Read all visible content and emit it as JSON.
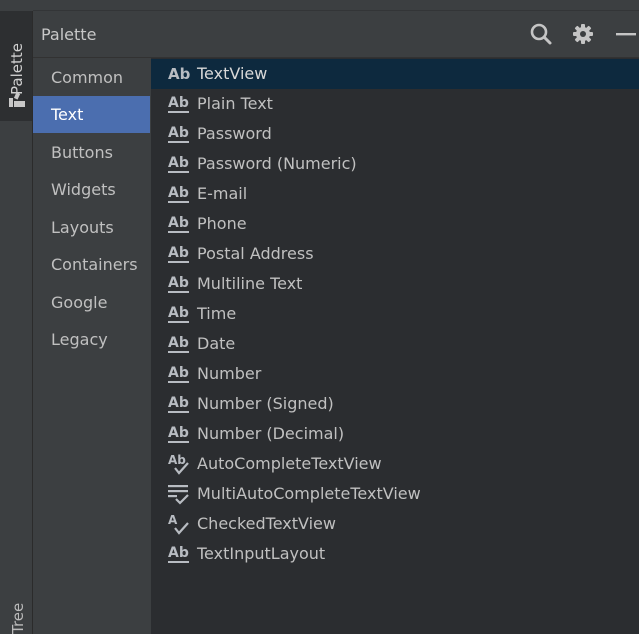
{
  "side_strip": {
    "palette_tab": "Palette",
    "tree_tab": "Tree"
  },
  "header": {
    "title": "Palette",
    "icons": [
      "search-icon",
      "gear-icon",
      "minimize-icon"
    ]
  },
  "categories": [
    {
      "label": "Common"
    },
    {
      "label": "Text",
      "selected": true
    },
    {
      "label": "Buttons"
    },
    {
      "label": "Widgets"
    },
    {
      "label": "Layouts"
    },
    {
      "label": "Containers"
    },
    {
      "label": "Google"
    },
    {
      "label": "Legacy"
    }
  ],
  "items": [
    {
      "label": "TextView",
      "icon": "textview-icon",
      "selected": true
    },
    {
      "label": "Plain Text",
      "icon": "edittext-icon"
    },
    {
      "label": "Password",
      "icon": "edittext-icon"
    },
    {
      "label": "Password (Numeric)",
      "icon": "edittext-icon"
    },
    {
      "label": "E-mail",
      "icon": "edittext-icon"
    },
    {
      "label": "Phone",
      "icon": "edittext-icon"
    },
    {
      "label": "Postal Address",
      "icon": "edittext-icon"
    },
    {
      "label": "Multiline Text",
      "icon": "edittext-icon"
    },
    {
      "label": "Time",
      "icon": "edittext-icon"
    },
    {
      "label": "Date",
      "icon": "edittext-icon"
    },
    {
      "label": "Number",
      "icon": "edittext-icon"
    },
    {
      "label": "Number (Signed)",
      "icon": "edittext-icon"
    },
    {
      "label": "Number (Decimal)",
      "icon": "edittext-icon"
    },
    {
      "label": "AutoCompleteTextView",
      "icon": "autocomplete-icon"
    },
    {
      "label": "MultiAutoCompleteTextView",
      "icon": "multiautocomplete-icon"
    },
    {
      "label": "CheckedTextView",
      "icon": "checkedtext-icon"
    },
    {
      "label": "TextInputLayout",
      "icon": "edittext-icon"
    }
  ],
  "colors": {
    "selected_category_bg": "#4b6eaf",
    "selected_item_bg": "#0d293e",
    "panel_bg": "#3c3f41",
    "list_bg": "#2b2d30"
  }
}
